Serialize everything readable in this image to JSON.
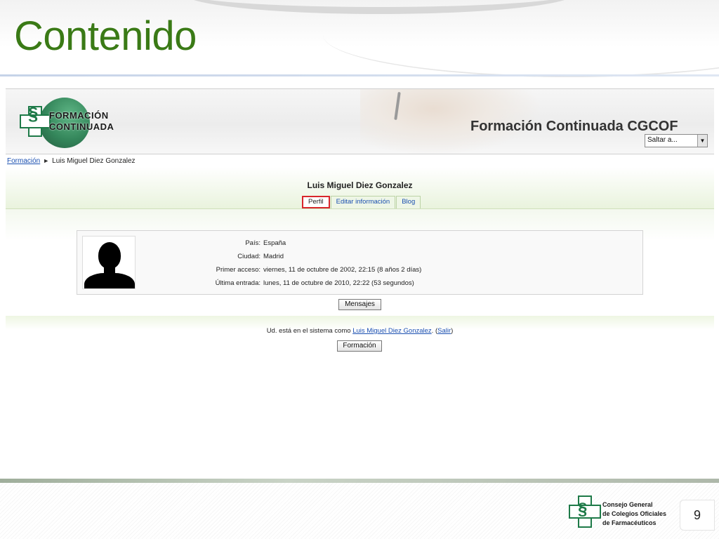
{
  "slide": {
    "title": "Contenido",
    "page_number": "9",
    "footer_logo": {
      "line1": "Consejo General",
      "line2": "de Colegios Oficiales",
      "line3": "de Farmacéuticos"
    }
  },
  "site": {
    "logo": {
      "line1": "FORMACIÓN",
      "line2": "CONTINUADA"
    },
    "title": "Formación Continuada CGCOF",
    "jump_select": {
      "value": "Saltar a..."
    }
  },
  "breadcrumb": {
    "home": "Formación",
    "separator": "►",
    "current": "Luis Miguel Diez Gonzalez"
  },
  "profile": {
    "name": "Luis Miguel Diez Gonzalez",
    "tabs": [
      {
        "label": "Perfil",
        "active": true
      },
      {
        "label": "Editar información",
        "active": false
      },
      {
        "label": "Blog",
        "active": false
      }
    ],
    "fields": [
      {
        "label": "País:",
        "value": "España"
      },
      {
        "label": "Ciudad:",
        "value": "Madrid"
      },
      {
        "label": "Primer acceso:",
        "value": "viernes, 11 de octubre de 2002, 22:15  (8 años 2 días)"
      },
      {
        "label": "Última entrada:",
        "value": "lunes, 11 de octubre de 2010, 22:22  (53 segundos)"
      }
    ],
    "messages_button": "Mensajes"
  },
  "footer": {
    "logged_prefix": "Ud. está en el sistema como ",
    "logged_user": "Luis Miguel Diez Gonzalez",
    "logout_open": ". (",
    "logout_label": "Salir",
    "logout_close": ")",
    "home_button": "Formación"
  }
}
